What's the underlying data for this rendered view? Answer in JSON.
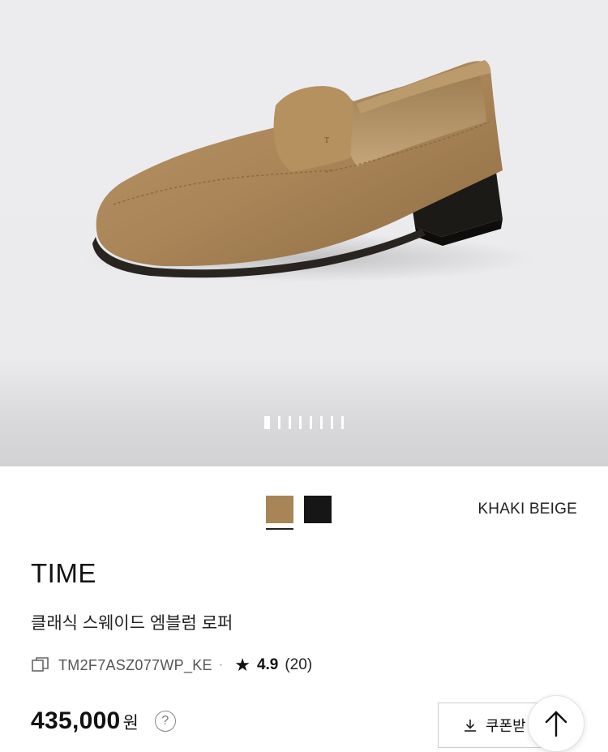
{
  "gallery": {
    "image_icon": "suede-loafer-product-photo",
    "slide_count": 8,
    "active_slide": 1
  },
  "colors": {
    "options": [
      {
        "name": "KHAKI BEIGE",
        "hex": "#a88557",
        "selected": true
      },
      {
        "name": "BLACK",
        "hex": "#161616",
        "selected": false
      }
    ],
    "selected_label": "KHAKI BEIGE"
  },
  "product": {
    "brand": "TIME",
    "name": "클래식 스웨이드 엠블럼 로퍼",
    "code": "TM2F7ASZ077WP_KE",
    "separator": "·",
    "rating_icon": "star-icon",
    "rating": "4.9",
    "review_count": "(20)"
  },
  "price": {
    "amount": "435,000",
    "currency": "원",
    "help": "?"
  },
  "actions": {
    "coupon_label": "쿠폰받",
    "coupon_icon": "download-icon",
    "top_icon": "arrow-up-icon"
  }
}
